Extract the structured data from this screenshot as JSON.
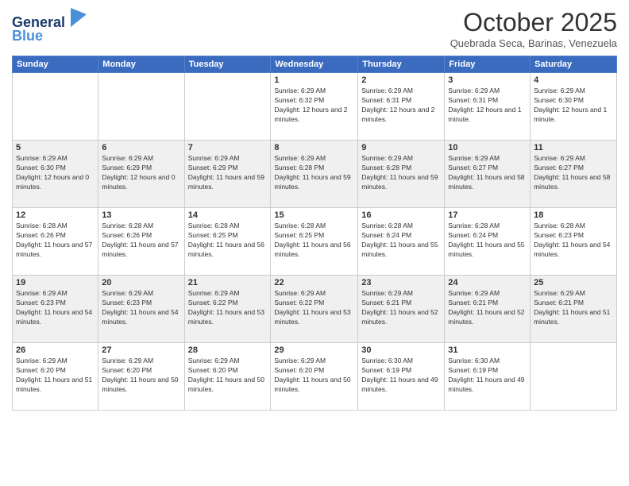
{
  "header": {
    "logo_line1": "General",
    "logo_line2": "Blue",
    "month_year": "October 2025",
    "location": "Quebrada Seca, Barinas, Venezuela"
  },
  "weekdays": [
    "Sunday",
    "Monday",
    "Tuesday",
    "Wednesday",
    "Thursday",
    "Friday",
    "Saturday"
  ],
  "weeks": [
    [
      {
        "day": "",
        "sunrise": "",
        "sunset": "",
        "daylight": ""
      },
      {
        "day": "",
        "sunrise": "",
        "sunset": "",
        "daylight": ""
      },
      {
        "day": "",
        "sunrise": "",
        "sunset": "",
        "daylight": ""
      },
      {
        "day": "1",
        "sunrise": "Sunrise: 6:29 AM",
        "sunset": "Sunset: 6:32 PM",
        "daylight": "Daylight: 12 hours and 2 minutes."
      },
      {
        "day": "2",
        "sunrise": "Sunrise: 6:29 AM",
        "sunset": "Sunset: 6:31 PM",
        "daylight": "Daylight: 12 hours and 2 minutes."
      },
      {
        "day": "3",
        "sunrise": "Sunrise: 6:29 AM",
        "sunset": "Sunset: 6:31 PM",
        "daylight": "Daylight: 12 hours and 1 minute."
      },
      {
        "day": "4",
        "sunrise": "Sunrise: 6:29 AM",
        "sunset": "Sunset: 6:30 PM",
        "daylight": "Daylight: 12 hours and 1 minute."
      }
    ],
    [
      {
        "day": "5",
        "sunrise": "Sunrise: 6:29 AM",
        "sunset": "Sunset: 6:30 PM",
        "daylight": "Daylight: 12 hours and 0 minutes."
      },
      {
        "day": "6",
        "sunrise": "Sunrise: 6:29 AM",
        "sunset": "Sunset: 6:29 PM",
        "daylight": "Daylight: 12 hours and 0 minutes."
      },
      {
        "day": "7",
        "sunrise": "Sunrise: 6:29 AM",
        "sunset": "Sunset: 6:29 PM",
        "daylight": "Daylight: 11 hours and 59 minutes."
      },
      {
        "day": "8",
        "sunrise": "Sunrise: 6:29 AM",
        "sunset": "Sunset: 6:28 PM",
        "daylight": "Daylight: 11 hours and 59 minutes."
      },
      {
        "day": "9",
        "sunrise": "Sunrise: 6:29 AM",
        "sunset": "Sunset: 6:28 PM",
        "daylight": "Daylight: 11 hours and 59 minutes."
      },
      {
        "day": "10",
        "sunrise": "Sunrise: 6:29 AM",
        "sunset": "Sunset: 6:27 PM",
        "daylight": "Daylight: 11 hours and 58 minutes."
      },
      {
        "day": "11",
        "sunrise": "Sunrise: 6:29 AM",
        "sunset": "Sunset: 6:27 PM",
        "daylight": "Daylight: 11 hours and 58 minutes."
      }
    ],
    [
      {
        "day": "12",
        "sunrise": "Sunrise: 6:28 AM",
        "sunset": "Sunset: 6:26 PM",
        "daylight": "Daylight: 11 hours and 57 minutes."
      },
      {
        "day": "13",
        "sunrise": "Sunrise: 6:28 AM",
        "sunset": "Sunset: 6:26 PM",
        "daylight": "Daylight: 11 hours and 57 minutes."
      },
      {
        "day": "14",
        "sunrise": "Sunrise: 6:28 AM",
        "sunset": "Sunset: 6:25 PM",
        "daylight": "Daylight: 11 hours and 56 minutes."
      },
      {
        "day": "15",
        "sunrise": "Sunrise: 6:28 AM",
        "sunset": "Sunset: 6:25 PM",
        "daylight": "Daylight: 11 hours and 56 minutes."
      },
      {
        "day": "16",
        "sunrise": "Sunrise: 6:28 AM",
        "sunset": "Sunset: 6:24 PM",
        "daylight": "Daylight: 11 hours and 55 minutes."
      },
      {
        "day": "17",
        "sunrise": "Sunrise: 6:28 AM",
        "sunset": "Sunset: 6:24 PM",
        "daylight": "Daylight: 11 hours and 55 minutes."
      },
      {
        "day": "18",
        "sunrise": "Sunrise: 6:28 AM",
        "sunset": "Sunset: 6:23 PM",
        "daylight": "Daylight: 11 hours and 54 minutes."
      }
    ],
    [
      {
        "day": "19",
        "sunrise": "Sunrise: 6:29 AM",
        "sunset": "Sunset: 6:23 PM",
        "daylight": "Daylight: 11 hours and 54 minutes."
      },
      {
        "day": "20",
        "sunrise": "Sunrise: 6:29 AM",
        "sunset": "Sunset: 6:23 PM",
        "daylight": "Daylight: 11 hours and 54 minutes."
      },
      {
        "day": "21",
        "sunrise": "Sunrise: 6:29 AM",
        "sunset": "Sunset: 6:22 PM",
        "daylight": "Daylight: 11 hours and 53 minutes."
      },
      {
        "day": "22",
        "sunrise": "Sunrise: 6:29 AM",
        "sunset": "Sunset: 6:22 PM",
        "daylight": "Daylight: 11 hours and 53 minutes."
      },
      {
        "day": "23",
        "sunrise": "Sunrise: 6:29 AM",
        "sunset": "Sunset: 6:21 PM",
        "daylight": "Daylight: 11 hours and 52 minutes."
      },
      {
        "day": "24",
        "sunrise": "Sunrise: 6:29 AM",
        "sunset": "Sunset: 6:21 PM",
        "daylight": "Daylight: 11 hours and 52 minutes."
      },
      {
        "day": "25",
        "sunrise": "Sunrise: 6:29 AM",
        "sunset": "Sunset: 6:21 PM",
        "daylight": "Daylight: 11 hours and 51 minutes."
      }
    ],
    [
      {
        "day": "26",
        "sunrise": "Sunrise: 6:29 AM",
        "sunset": "Sunset: 6:20 PM",
        "daylight": "Daylight: 11 hours and 51 minutes."
      },
      {
        "day": "27",
        "sunrise": "Sunrise: 6:29 AM",
        "sunset": "Sunset: 6:20 PM",
        "daylight": "Daylight: 11 hours and 50 minutes."
      },
      {
        "day": "28",
        "sunrise": "Sunrise: 6:29 AM",
        "sunset": "Sunset: 6:20 PM",
        "daylight": "Daylight: 11 hours and 50 minutes."
      },
      {
        "day": "29",
        "sunrise": "Sunrise: 6:29 AM",
        "sunset": "Sunset: 6:20 PM",
        "daylight": "Daylight: 11 hours and 50 minutes."
      },
      {
        "day": "30",
        "sunrise": "Sunrise: 6:30 AM",
        "sunset": "Sunset: 6:19 PM",
        "daylight": "Daylight: 11 hours and 49 minutes."
      },
      {
        "day": "31",
        "sunrise": "Sunrise: 6:30 AM",
        "sunset": "Sunset: 6:19 PM",
        "daylight": "Daylight: 11 hours and 49 minutes."
      },
      {
        "day": "",
        "sunrise": "",
        "sunset": "",
        "daylight": ""
      }
    ]
  ]
}
